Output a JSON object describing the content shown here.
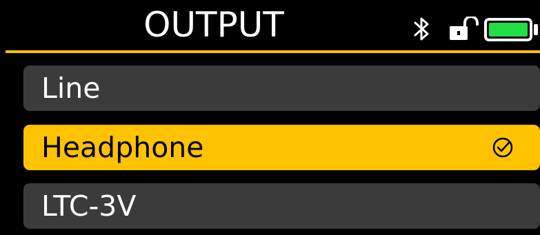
{
  "header": {
    "title": "OUTPUT",
    "status_icons": [
      "bluetooth-icon",
      "unlocked-padlock-icon",
      "battery-full-icon"
    ]
  },
  "colors": {
    "background": "#000000",
    "accent": "#fec300",
    "item_background": "#3b3b3b",
    "text_light": "#ffffff",
    "text_dark": "#000000",
    "battery_fill": "#22dd44"
  },
  "battery": {
    "level": 1.0
  },
  "options": [
    {
      "label": "Line",
      "selected": false
    },
    {
      "label": "Headphone",
      "selected": true
    },
    {
      "label": "LTC-3V",
      "selected": false
    }
  ]
}
